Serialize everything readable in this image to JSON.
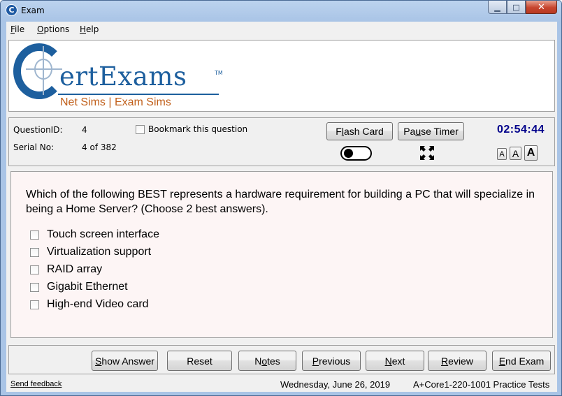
{
  "window": {
    "title": "Exam",
    "app_icon_letter": "C",
    "min": "▁",
    "max": "□",
    "close": "✕"
  },
  "menu": {
    "file": {
      "first": "F",
      "rest": "ile"
    },
    "options": {
      "first": "O",
      "rest": "ptions"
    },
    "help": {
      "first": "H",
      "rest": "elp"
    }
  },
  "logo": {
    "brand": "ertExams",
    "tm": "TM",
    "tagline": "Net Sims | Exam Sims",
    "brand_color": "#1d5f9e",
    "tagline_color": "#c1601b"
  },
  "info": {
    "question_id_label": "QuestionID:",
    "question_id": "4",
    "serial_label": "Serial No:",
    "serial": "4 of 382",
    "bookmark_label": "Bookmark this question",
    "bookmark_checked": false,
    "flash_card": {
      "pre": "F",
      "u": "l",
      "post": "ash Card"
    },
    "pause_timer": {
      "pre": "Pa",
      "u": "u",
      "post": "se Timer"
    },
    "timer": "02:54:44",
    "timer_color": "#00008b",
    "toggle_on": false,
    "font_small": "A",
    "font_medium": "A",
    "font_large": "A"
  },
  "question": {
    "text": "Which of the following BEST represents a hardware requirement for building a PC that will specialize in being a Home Server? (Choose 2 best answers).",
    "options": [
      {
        "label": "Touch screen interface",
        "checked": false
      },
      {
        "label": "Virtualization support",
        "checked": false
      },
      {
        "label": "RAID array",
        "checked": false
      },
      {
        "label": "Gigabit Ethernet",
        "checked": false
      },
      {
        "label": "High-end Video card",
        "checked": false
      }
    ]
  },
  "buttons": {
    "show_answer": {
      "u": "S",
      "post": "how Answer"
    },
    "reset": "Reset",
    "notes": {
      "pre": "N",
      "u": "o",
      "post": "tes"
    },
    "previous": {
      "u": "P",
      "post": "revious"
    },
    "next": {
      "u": "N",
      "post": "ext"
    },
    "review": {
      "u": "R",
      "post": "eview"
    },
    "end_exam": {
      "u": "E",
      "post": "nd Exam"
    }
  },
  "status": {
    "feedback": "Send feedback",
    "date": "Wednesday, June 26, 2019",
    "product": "A+Core1-220-1001 Practice Tests"
  }
}
